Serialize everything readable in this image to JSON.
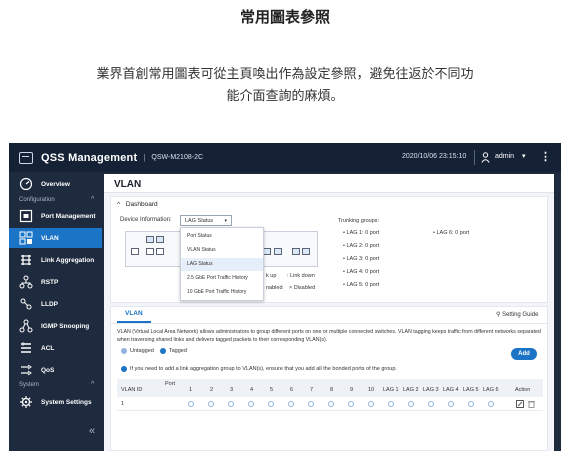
{
  "page": {
    "title": "常用圖表參照",
    "description_line1": "業界首創常用圖表可從主頁喚出作為設定參照，避免往返於不同功",
    "description_line2": "能介面查詢的麻煩。"
  },
  "topbar": {
    "app_name": "QSS Management",
    "separator": "|",
    "model": "QSW-M2108-2C",
    "datetime": "2020/10/06  23:15:10",
    "user": "admin",
    "user_caret": "▾",
    "more": "⋮"
  },
  "sidebar": {
    "items": [
      {
        "label": "Overview",
        "icon": "gauge-icon"
      },
      {
        "label": "Port Management",
        "icon": "port-icon"
      },
      {
        "label": "VLAN",
        "icon": "vlan-icon"
      },
      {
        "label": "Link Aggregation",
        "icon": "link-aggregation-icon"
      },
      {
        "label": "RSTP",
        "icon": "rstp-icon"
      },
      {
        "label": "LLDP",
        "icon": "lldp-icon"
      },
      {
        "label": "IGMP Snooping",
        "icon": "igmp-icon"
      },
      {
        "label": "ACL",
        "icon": "acl-icon"
      },
      {
        "label": "QoS",
        "icon": "qos-icon"
      },
      {
        "label": "System Settings",
        "icon": "gear-icon"
      }
    ],
    "section_configuration": "Configuration",
    "section_system": "System",
    "collapse": "«"
  },
  "content": {
    "title": "VLAN",
    "dashboard": {
      "header": "Dashboard",
      "collapse_glyph": "^",
      "device_info_label": "Device Information:",
      "selected_view": "LAG Status",
      "select_caret": "▾",
      "dropdown_options": [
        "Port Status",
        "VLAN Status",
        "LAG Status",
        "2.5 GbE Port Traffic History",
        "10 GbE Port Traffic History"
      ],
      "legend_up": "k up",
      "legend_down": ": Link down",
      "legend_enabled": "nabled",
      "legend_disabled": "× Disabled",
      "trunking_header": "Trunking groups:",
      "trunk_groups": [
        {
          "name": "LAG 1:",
          "value": "0 port"
        },
        {
          "name": "LAG 2:",
          "value": "0 port"
        },
        {
          "name": "LAG 3:",
          "value": "0 port"
        },
        {
          "name": "LAG 4:",
          "value": "0 port"
        },
        {
          "name": "LAG 5:",
          "value": "0 port"
        },
        {
          "name": "LAG 6:",
          "value": "0 port"
        }
      ]
    },
    "vlan_panel": {
      "tab": "VLAN",
      "setting_guide": "Setting Guide",
      "description": "VLAN (Virtual Local Area Network) allows administrators to group different ports on one or multiple connected switches. VLAN tagging keeps traffic from different networks separated when traversing shared links and delivers tagged packets to their corresponding VLAN(s).",
      "untagged": "Untagged",
      "tagged": "Tagged",
      "add_button": "Add",
      "info": "If you need to add a link aggregation group to VLAN(s), ensure that you add all the bonded ports of the group.",
      "columns": [
        "VLAN ID",
        "Port",
        "1",
        "2",
        "3",
        "4",
        "5",
        "6",
        "7",
        "8",
        "9",
        "10",
        "LAG 1",
        "LAG 2",
        "LAG 3",
        "LAG 4",
        "LAG 5",
        "LAG 6",
        "Action"
      ],
      "rows": [
        {
          "vlan_id": "1"
        }
      ]
    }
  },
  "colors": {
    "topbar_bg": "#152236",
    "sidebar_bg": "#1e2a3d",
    "accent": "#1b74c5",
    "tagged_dot": "#1b74c5",
    "untagged_dot": "#8fb3de"
  }
}
